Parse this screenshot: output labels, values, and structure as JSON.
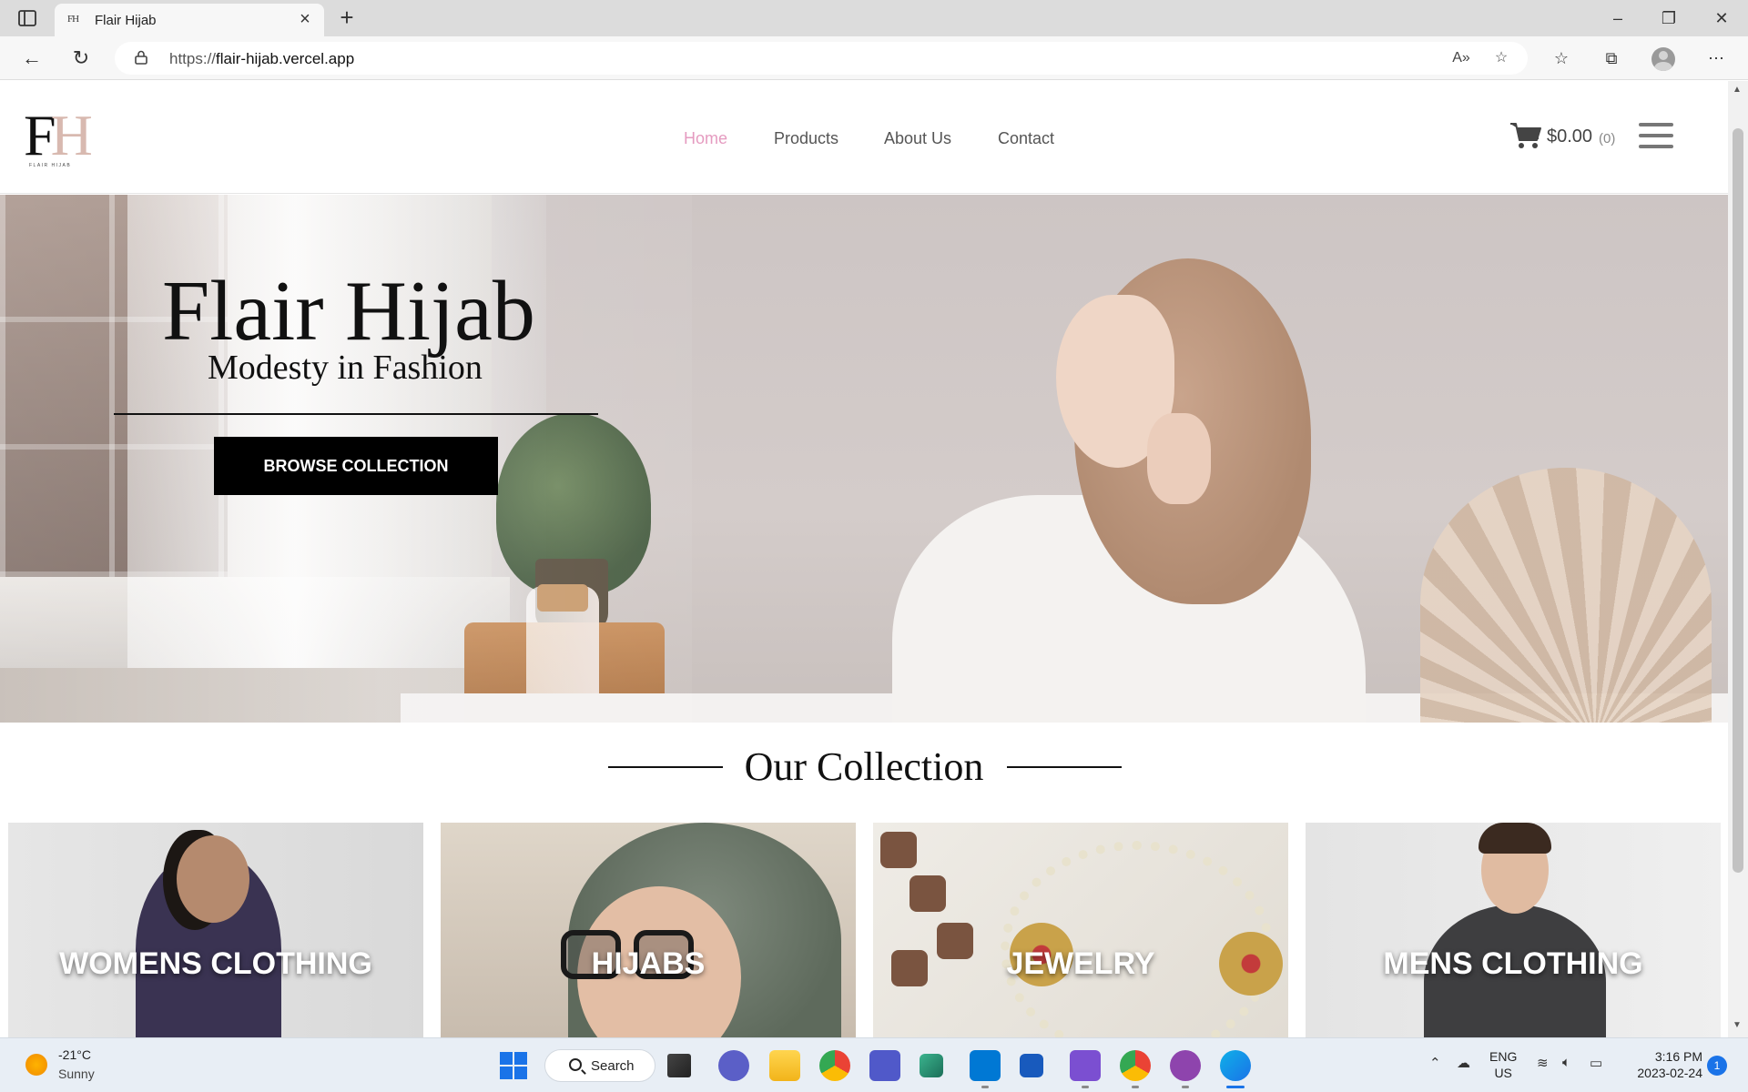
{
  "browser": {
    "tab_title": "Flair Hijab",
    "tab_favicon_text": "FH",
    "url_prefix": "https://",
    "url_host": "flair-hijab.vercel.app"
  },
  "site": {
    "logo_f": "F",
    "logo_h": "H",
    "logo_tagline": "FLAIR HIJAB",
    "nav": [
      "Home",
      "Products",
      "About Us",
      "Contact"
    ],
    "active_nav": "Home",
    "active_color": "#e59bc0",
    "cart_total": "$0.00",
    "cart_count": "(0)"
  },
  "hero": {
    "title": "Flair Hijab",
    "subtitle": "Modesty in Fashion",
    "button_label": "BROWSE COLLECTION"
  },
  "collection": {
    "title": "Our Collection",
    "cards": [
      "WOMENS CLOTHING",
      "HIJABS",
      "JEWELRY",
      "MENS CLOTHING"
    ]
  },
  "taskbar": {
    "weather_temp": "-21°C",
    "weather_condition": "Sunny",
    "search_label": "Search",
    "lang_top": "ENG",
    "lang_bottom": "US",
    "time": "3:16 PM",
    "date": "2023-02-24",
    "notification_count": "1",
    "apps": [
      "task-view-icon",
      "meet-icon",
      "file-explorer-icon",
      "chrome-icon",
      "teams-icon",
      "app-icon",
      "vscode-icon",
      "word-icon",
      "visual-studio-icon",
      "chrome-profile-icon",
      "github-desktop-icon",
      "edge-icon"
    ]
  },
  "colors": {
    "accent_pink": "#e59bc0",
    "button_black": "#000000",
    "windows_blue": "#1a73e8"
  }
}
